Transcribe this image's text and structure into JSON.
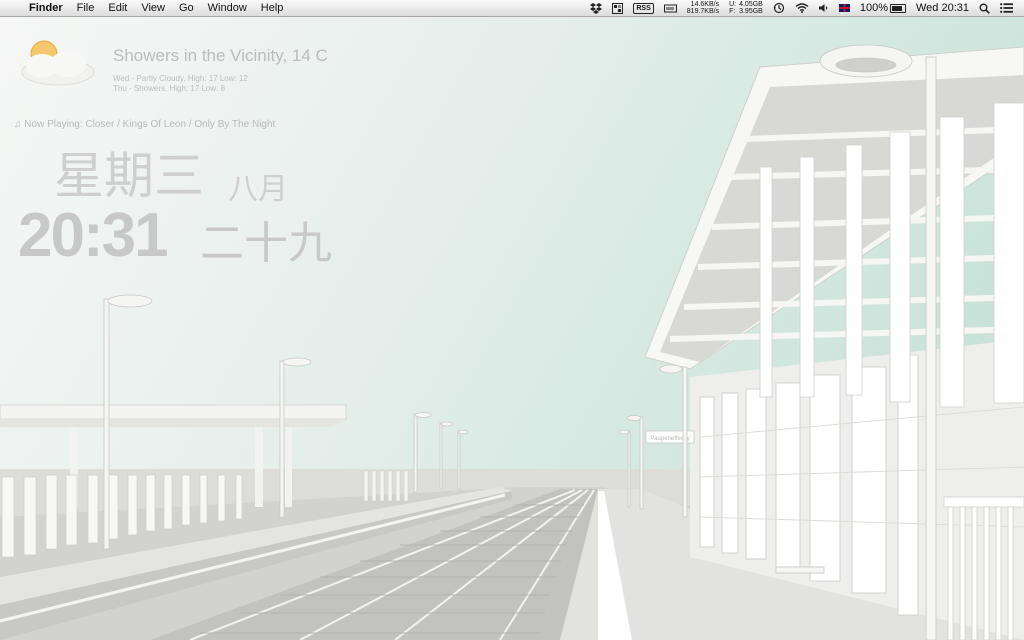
{
  "menubar": {
    "apple_glyph": "",
    "app_name": "Finder",
    "menus": [
      "File",
      "Edit",
      "View",
      "Go",
      "Window",
      "Help"
    ],
    "extras": {
      "rss_label": "RSS",
      "net_down": "14.6KB/s",
      "net_up": "819.7KB/s",
      "disk_u_label": "U:",
      "disk_f_label": "F:",
      "disk_u": "4.05GB",
      "disk_f": "3.95GB",
      "battery": "100%",
      "clock": "Wed 20:31"
    }
  },
  "weather": {
    "condition": "Showers in the Vicinity, 14 C",
    "forecast": [
      "Wed - Partly Cloudy, High: 17 Low: 12",
      "Thu - Showers, High: 17 Low: 8"
    ]
  },
  "now_playing": "Now Playing: Closer / Kings Of Leon / Only By The Night",
  "clock": {
    "weekday": "星期三",
    "month": "八月",
    "time": "20:31",
    "day": "二十九"
  },
  "wallpaper": {
    "station_sign": "Paupeneffecky",
    "colors": {
      "sky": "#cfe6de",
      "platform": "#dadad6",
      "structure": "#f6f6f4"
    }
  }
}
